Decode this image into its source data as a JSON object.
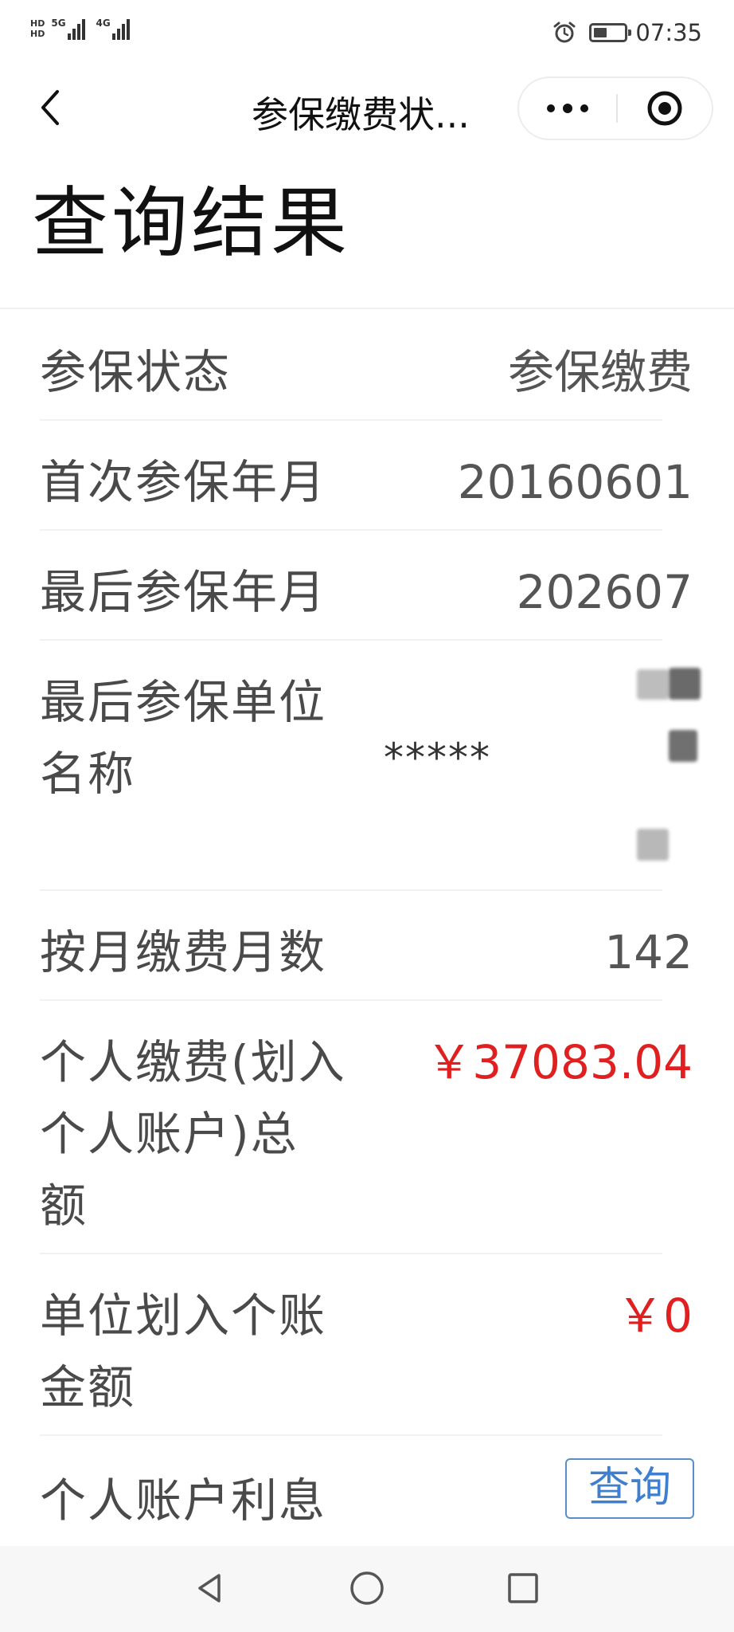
{
  "status_bar": {
    "hd_top": "HD",
    "hd_bottom": "HD",
    "net_1": "5G",
    "net_2": "4G",
    "time": "07:35"
  },
  "nav": {
    "title": "参保缴费状..."
  },
  "page": {
    "heading": "查询结果"
  },
  "rows": [
    {
      "label": "参保状态",
      "value": "参保缴费"
    },
    {
      "label": "首次参保年月",
      "value": "20160601"
    },
    {
      "label": "最后参保年月",
      "value": "202607"
    },
    {
      "label_line1": "最后参保单位",
      "label_line2": "名称",
      "value": "*****"
    },
    {
      "label": "按月缴费月数",
      "value": "142"
    },
    {
      "label_line1": "个人缴费(划入",
      "label_line2": "个人账户)总",
      "label_line3": "额",
      "value": "￥37083.04"
    },
    {
      "label_line1": "单位划入个账",
      "label_line2": "金额",
      "value": "￥0"
    },
    {
      "label": "个人账户利息",
      "button": "查询"
    }
  ],
  "colors": {
    "money": "#e02020",
    "link": "#3f7fcf"
  }
}
